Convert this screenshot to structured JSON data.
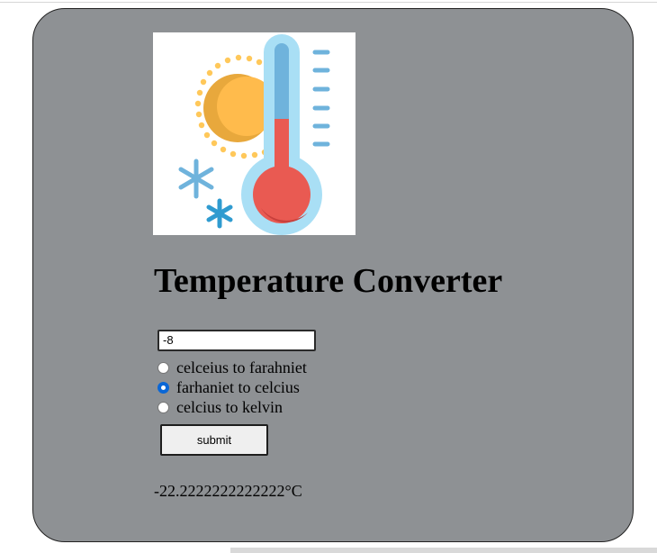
{
  "page": {
    "title": "Temperature Converter",
    "colors": {
      "card_background": "#8e9194",
      "radio_checked": "#0a67d6"
    }
  },
  "hero": {
    "icon": "thermometer-sun-snowflake-illustration"
  },
  "form": {
    "input_value": "-8",
    "options": [
      {
        "label": "celceius to farahniet",
        "checked": false
      },
      {
        "label": "farhaniet to celcius",
        "checked": true
      },
      {
        "label": "celcius to kelvin",
        "checked": false
      }
    ],
    "submit_label": "submit"
  },
  "result": {
    "text": "-22.2222222222222°C"
  }
}
